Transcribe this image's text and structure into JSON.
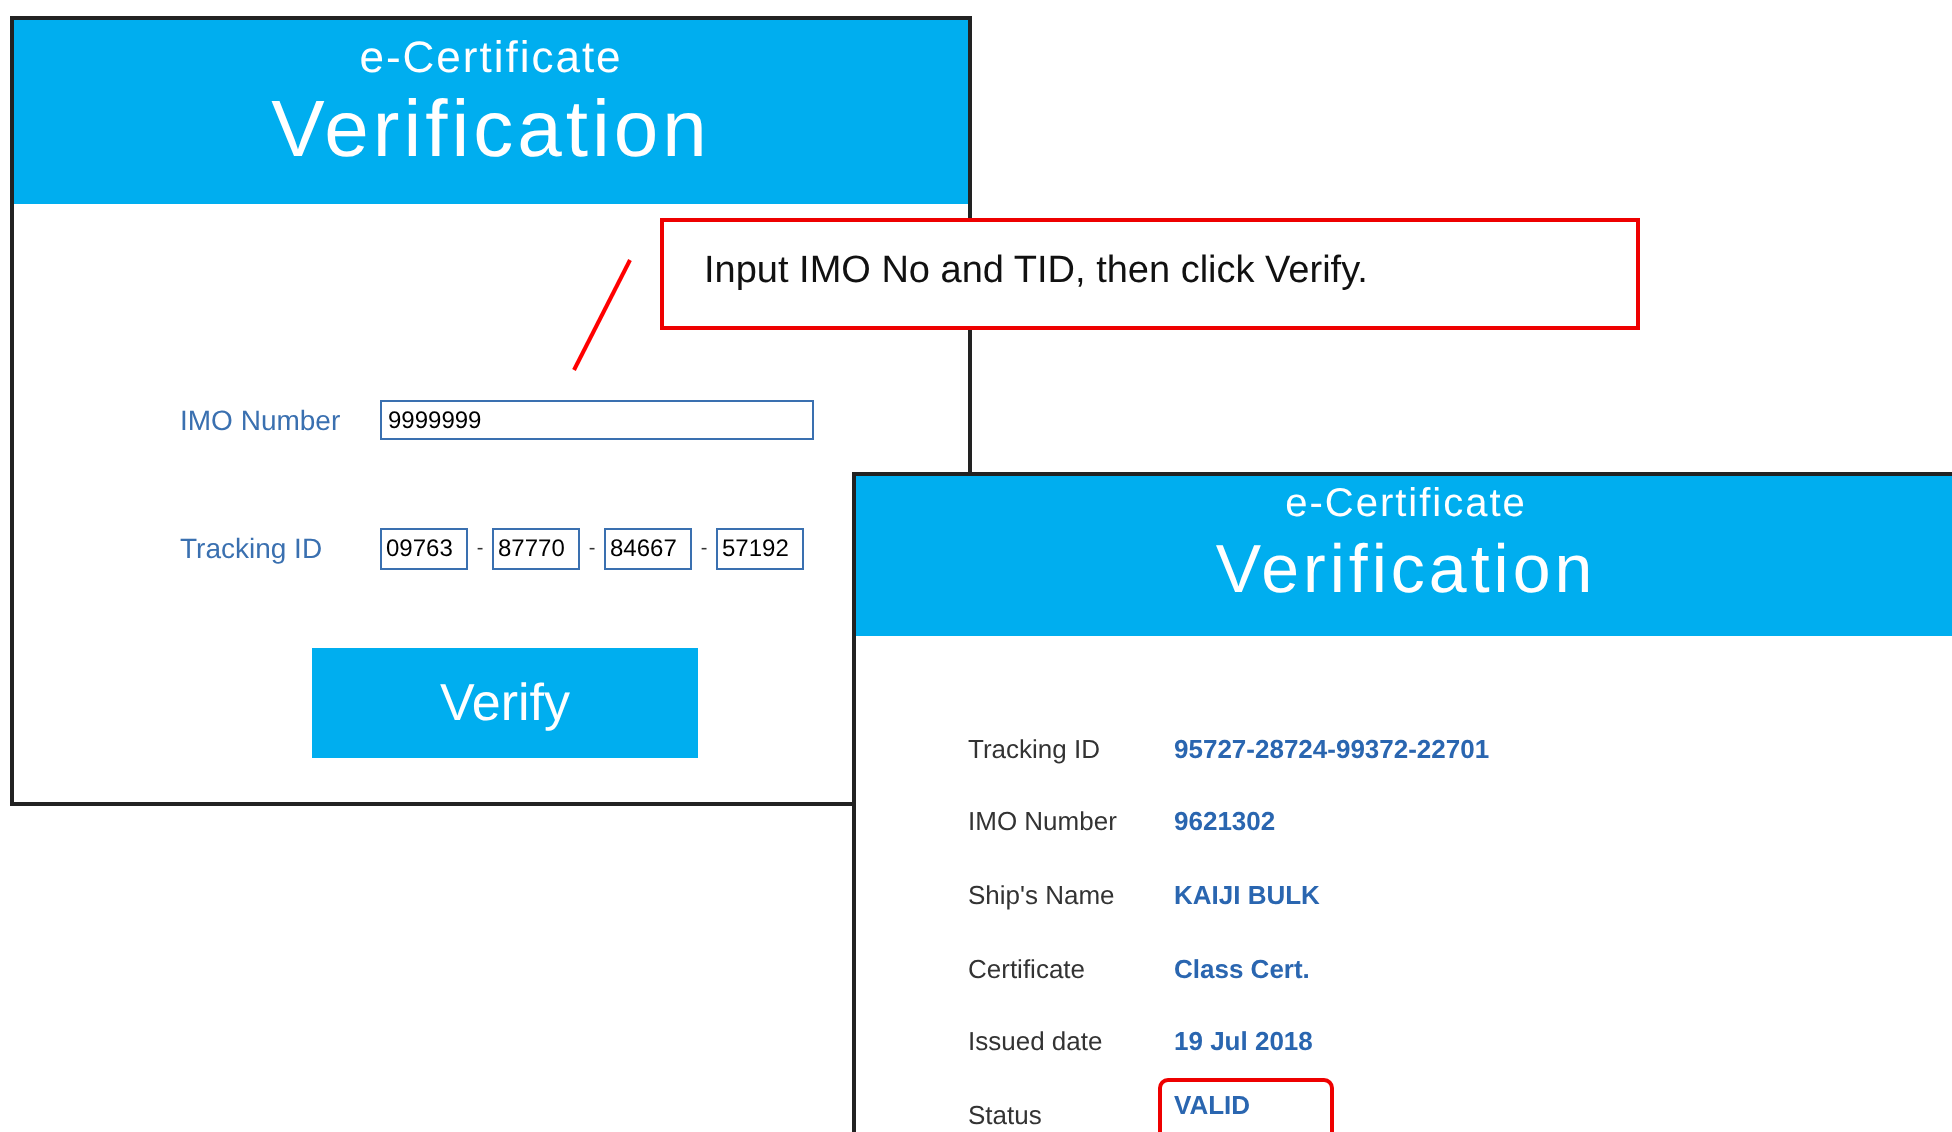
{
  "input_window": {
    "subtitle": "e-Certificate",
    "title": "Verification",
    "imo_label": "IMO Number",
    "imo_value": "9999999",
    "tracking_label": "Tracking ID",
    "tracking_parts": [
      "09763",
      "87770",
      "84667",
      "57192"
    ],
    "separator": "-",
    "button": "Verify"
  },
  "callout": {
    "text": "Input IMO No and TID, then click Verify."
  },
  "result_window": {
    "subtitle": "e-Certificate",
    "title": "Verification",
    "rows": [
      {
        "label": "Tracking ID",
        "value": "95727-28724-99372-22701",
        "highlighted": false
      },
      {
        "label": "IMO Number",
        "value": "9621302",
        "highlighted": false
      },
      {
        "label": "Ship's Name",
        "value": "KAIJI  BULK",
        "highlighted": false
      },
      {
        "label": "Certificate",
        "value": "Class Cert.",
        "highlighted": false
      },
      {
        "label": "Issued date",
        "value": "19 Jul 2018",
        "highlighted": false
      },
      {
        "label": "Status",
        "value": "VALID",
        "highlighted": true
      }
    ]
  }
}
